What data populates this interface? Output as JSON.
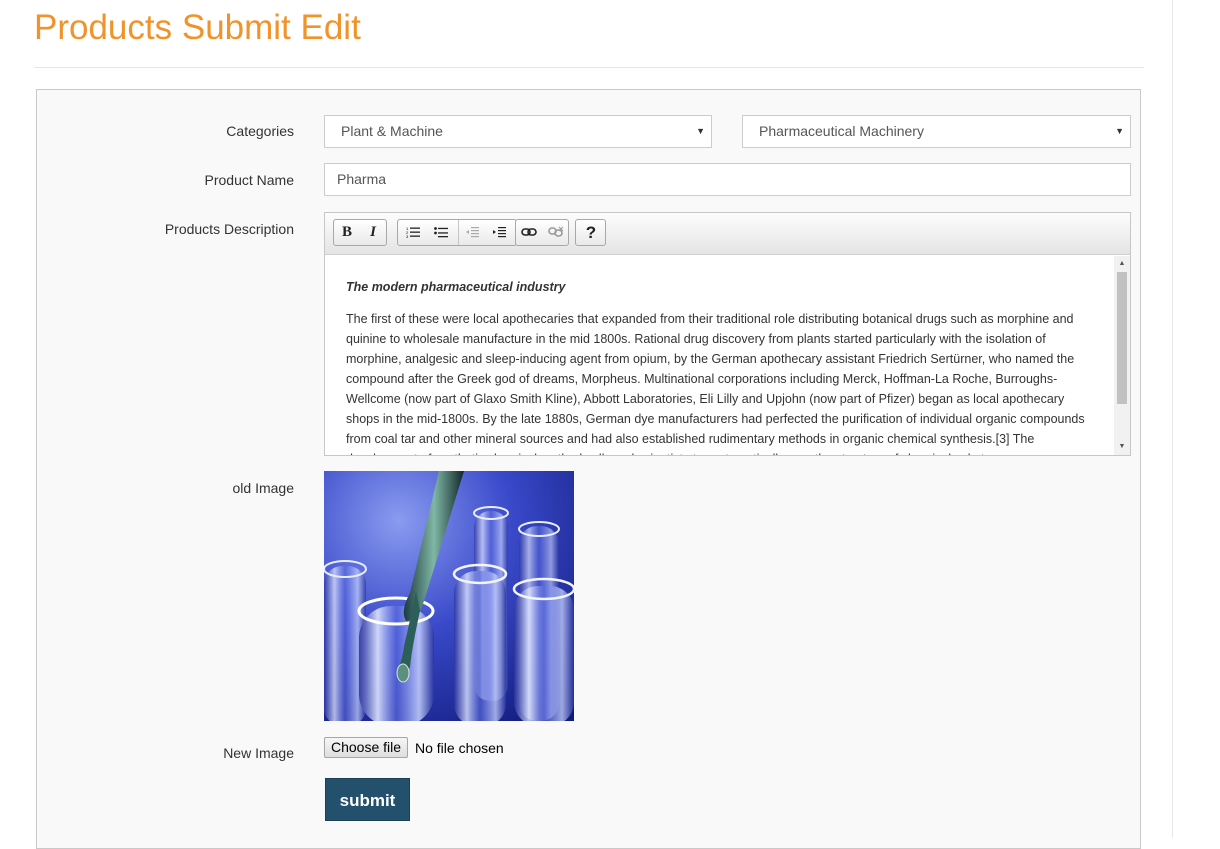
{
  "page": {
    "title": "Products Submit Edit"
  },
  "form": {
    "categories_label": "Categories",
    "category_selected": "Plant & Machine",
    "subcategory_selected": "Pharmaceutical Machinery",
    "product_name_label": "Product Name",
    "product_name_value": "Pharma",
    "description_label": "Products Description",
    "old_image_label": "old Image",
    "new_image_label": "New Image",
    "choose_file_label": "Choose file",
    "no_file_text": "No file chosen",
    "submit_label": "submit"
  },
  "editor": {
    "toolbar": {
      "bold": "B",
      "italic": "I",
      "help": "?"
    },
    "heading": "The modern pharmaceutical industry",
    "paragraph": " The first of these were local apothecaries that expanded from their traditional role distributing botanical drugs such as morphine and quinine to wholesale manufacture in the mid 1800s. Rational drug discovery from plants started particularly with the isolation of morphine, analgesic and sleep-inducing agent from opium, by the German apothecary assistant Friedrich Sertürner, who named the compound after the Greek god of dreams, Morpheus. Multinational corporations including Merck, Hoffman-La Roche, Burroughs-Wellcome (now part of Glaxo Smith Kline), Abbott Laboratories, Eli Lilly and Upjohn (now part of Pfizer) began as local apothecary shops in the mid-1800s. By the late 1880s, German dye manufacturers had perfected the purification of individual organic compounds from coal tar and other mineral sources and had also established rudimentary methods in organic chemical synthesis.[3] The development of synthetic chemical methods allowed scientists to systematically vary the structure of chemical substances."
  },
  "colors": {
    "title": "#f0932b",
    "submit_bg": "#23506d",
    "panel_bg": "#f9f9f9"
  },
  "icons": [
    "bold-icon",
    "italic-icon",
    "ordered-list-icon",
    "unordered-list-icon",
    "outdent-icon",
    "indent-icon",
    "link-icon",
    "unlink-icon",
    "help-icon",
    "chevron-down-icon"
  ]
}
